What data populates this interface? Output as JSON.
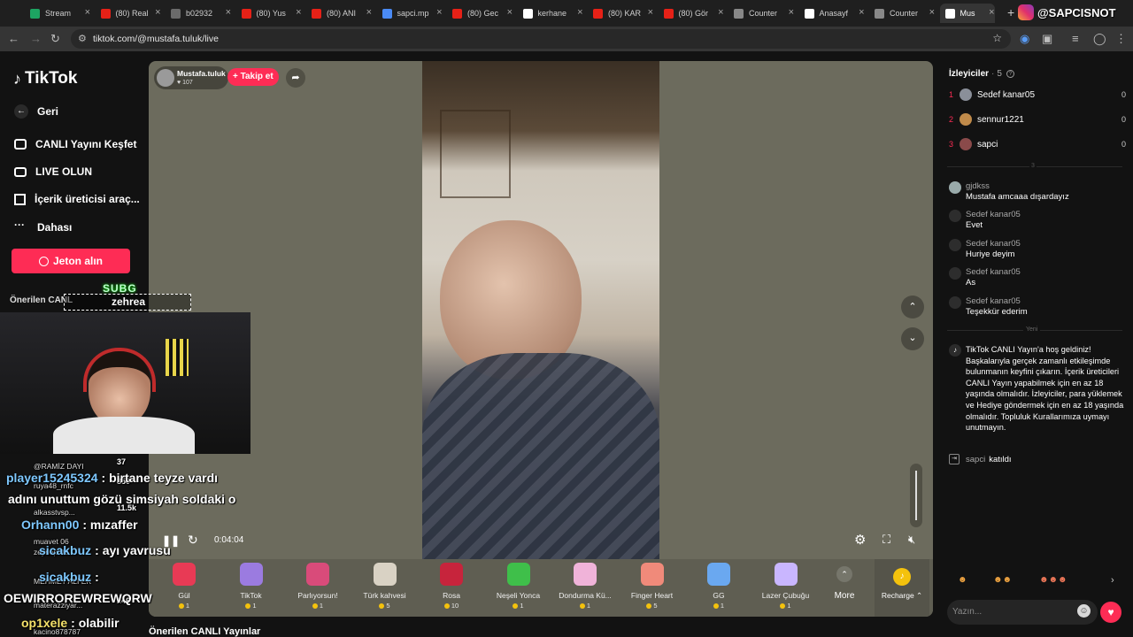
{
  "browser": {
    "tabs": [
      {
        "label": "Stream",
        "color": "#1da462"
      },
      {
        "label": "(80) Real",
        "color": "#e62117"
      },
      {
        "label": "b02932",
        "color": "#6b6b6b"
      },
      {
        "label": "(80) Yus",
        "color": "#e62117"
      },
      {
        "label": "(80) ANI",
        "color": "#e62117"
      },
      {
        "label": "sapci.mp",
        "color": "#4a8af4"
      },
      {
        "label": "(80) Gec",
        "color": "#e62117"
      },
      {
        "label": "kerhane",
        "color": "#ffffff"
      },
      {
        "label": "(80) KAR",
        "color": "#e62117"
      },
      {
        "label": "(80) Gör",
        "color": "#e62117"
      },
      {
        "label": "Counter",
        "color": "#888888"
      },
      {
        "label": "Anasayf",
        "color": "#ffffff"
      },
      {
        "label": "Counter",
        "color": "#888888"
      },
      {
        "label": "Mus",
        "color": "#ffffff"
      }
    ],
    "url": "tiktok.com/@mustafa.tuluk/live"
  },
  "watermark": "@SAPCISNOT",
  "sidebar": {
    "logo": "TikTok",
    "back": "Geri",
    "items": [
      "CANLI Yayını Keşfet",
      "LIVE OLUN",
      "İçerik üreticisi araç...",
      "Dahası"
    ],
    "coins_button": "Jeton alın",
    "suggested": "Önerilen CANLI Yayınlar",
    "suggested_partial": "Önerilen CANL"
  },
  "host": {
    "name": "Mustafa.tuluk",
    "likes": "107",
    "follow": "+ Takip et"
  },
  "player": {
    "time": "0:04:04"
  },
  "gifts": [
    {
      "name": "Gül",
      "price": "1",
      "color": "#e83a55"
    },
    {
      "name": "TikTok",
      "price": "1",
      "color": "#9b7be0"
    },
    {
      "name": "Parlıyorsun!",
      "price": "1",
      "color": "#d94b7a"
    },
    {
      "name": "Türk kahvesi",
      "price": "5",
      "color": "#d9d2c4"
    },
    {
      "name": "Rosa",
      "price": "10",
      "color": "#c7243c"
    },
    {
      "name": "Neşeli Yonca",
      "price": "1",
      "color": "#3fbf4a"
    },
    {
      "name": "Dondurma Kü...",
      "price": "1",
      "color": "#f0b3d9"
    },
    {
      "name": "Finger Heart",
      "price": "5",
      "color": "#f08a7a"
    },
    {
      "name": "GG",
      "price": "1",
      "color": "#6aa8f0"
    },
    {
      "name": "Lazer Çubuğu",
      "price": "1",
      "color": "#c9b6ff"
    }
  ],
  "gift_more": "More",
  "recharge": "Recharge",
  "viewers": {
    "title": "İzleyiciler",
    "count": "5",
    "list": [
      {
        "rank": "1",
        "name": "Sedef kanar05",
        "score": "0"
      },
      {
        "rank": "2",
        "name": "sennur1221",
        "score": "0"
      },
      {
        "rank": "3",
        "name": "sapci",
        "score": "0"
      }
    ],
    "divider": "3"
  },
  "comments": [
    {
      "user": "gjdkss",
      "text": "Mustafa amcaaa dışardayız"
    },
    {
      "user": "Sedef kanar05",
      "text": "Evet"
    },
    {
      "user": "Sedef kanar05",
      "text": "Huriye deyim"
    },
    {
      "user": "Sedef kanar05",
      "text": "As"
    },
    {
      "user": "Sedef kanar05",
      "text": "Teşekkür ederim"
    }
  ],
  "new_label": "Yeni",
  "welcome": "TikTok CANLI Yayın'a hoş geldiniz! Başkalarıyla gerçek zamanlı etkileşimde bulunmanın keyfini çıkarın. İçerik üreticileri CANLI Yayın yapabilmek için en az 18 yaşında olmalıdır. İzleyiciler, para yüklemek ve Hediye göndermek için en az 18 yaşında olmalıdır. Topluluk Kurallarımıza uymayı unutmayın.",
  "joined": {
    "user": "sapci",
    "text": "katıldı"
  },
  "input_placeholder": "Yazın...",
  "stream_overlay": {
    "sub_label": "SUBG",
    "sub_name": "zehrea",
    "leaderboard": [
      {
        "name": "@RAMİZ DAYI",
        "value": "37"
      },
      {
        "name": "ruya48_rnfc",
        "value": "850"
      },
      {
        "name": "alkasstvsp...",
        "value": "11.5k"
      },
      {
        "name": "muavet 06",
        "value": ""
      },
      {
        "name": "zeynep 06",
        "value": ""
      },
      {
        "name": "MEHMET ALİ EK",
        "value": ""
      },
      {
        "name": "materazziyar...",
        "value": "146"
      },
      {
        "name": "kacino878787",
        "value": ""
      }
    ],
    "chat": [
      {
        "user": "player15245324",
        "text": ": birtane teyze vardı"
      },
      {
        "user": "",
        "text": "adını unuttum gözü simsiyah soldaki o"
      },
      {
        "user": "Orhann00",
        "text": ": mızaffer"
      },
      {
        "user": "sicakbuz",
        "text": ": ayı yavrusu"
      },
      {
        "user": "sicakbuz",
        "text": ":"
      },
      {
        "user": "OEWIRROREWREWQRW",
        "text": ""
      },
      {
        "user": "op1xele",
        "text": ": olabilir"
      }
    ]
  }
}
